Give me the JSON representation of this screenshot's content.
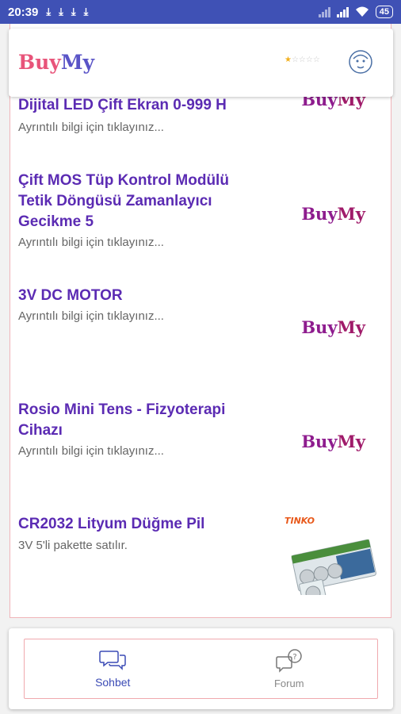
{
  "status_bar": {
    "time": "20:39",
    "battery": "45"
  },
  "header": {
    "brand_part1": "Buy",
    "brand_part2": "My",
    "rating_filled": 1,
    "rating_total": 5
  },
  "items": [
    {
      "title": "Dijital LED Çift Ekran 0-999 H",
      "subtitle": "Ayrıntılı bilgi için tıklayınız...",
      "logo_part1": "Buy",
      "logo_part2": "My"
    },
    {
      "title": "Çift MOS Tüp Kontrol Modülü Tetik Döngüsü Zamanlayıcı Gecikme 5",
      "subtitle": "Ayrıntılı bilgi için tıklayınız...",
      "logo_part1": "Buy",
      "logo_part2": "My"
    },
    {
      "title": "3V DC MOTOR",
      "subtitle": "Ayrıntılı bilgi için tıklayınız...",
      "logo_part1": "Buy",
      "logo_part2": "My"
    },
    {
      "title": "Rosio Mini Tens - Fizyoterapi Cihazı",
      "subtitle": "Ayrıntılı bilgi için tıklayınız...",
      "logo_part1": "Buy",
      "logo_part2": "My"
    },
    {
      "title": "CR2032 Lityum Düğme Pil",
      "subtitle": "3V 5'li pakette satılır.",
      "image_brand": "TINKO"
    }
  ],
  "bottom_nav": {
    "tabs": [
      {
        "label": "Sohbet",
        "icon": "chat-bubbles-icon"
      },
      {
        "label": "Forum",
        "icon": "forum-question-icon"
      }
    ]
  },
  "colors": {
    "status_bar": "#3f51b5",
    "title": "#5b2bb3",
    "border": "#f0b5b9",
    "active_tab": "#3b4bb5"
  }
}
